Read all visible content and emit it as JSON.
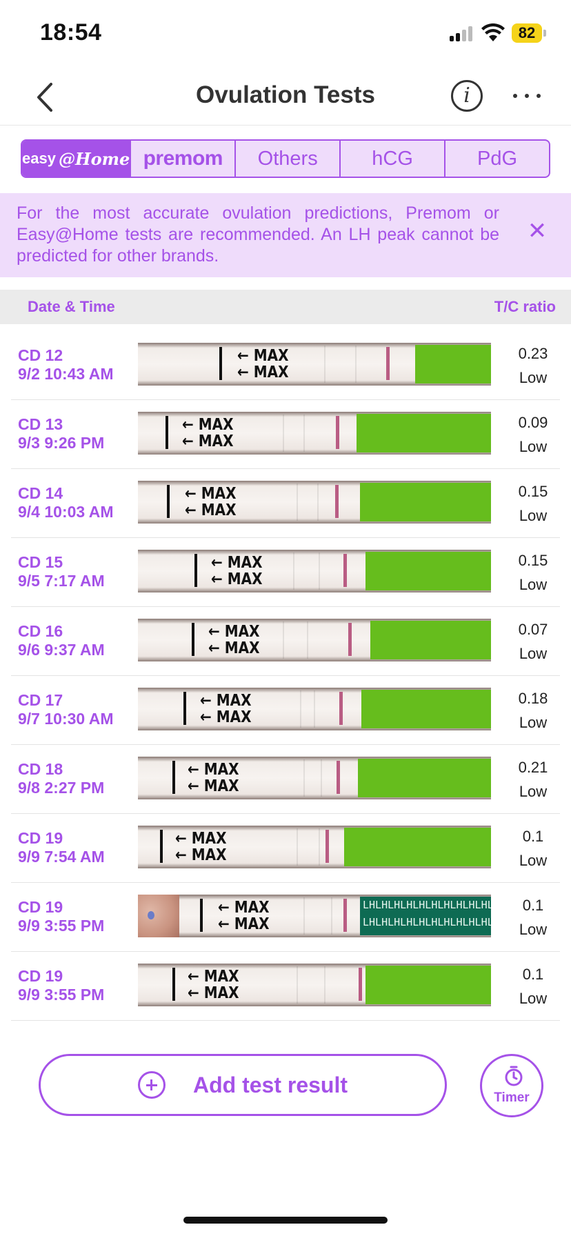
{
  "status": {
    "time": "18:54",
    "battery": "82"
  },
  "nav": {
    "title": "Ovulation Tests",
    "back_icon": "chevron-left-icon",
    "info_icon": "info-icon",
    "more_icon": "more-icon"
  },
  "tabs": [
    {
      "label_a": "easy",
      "label_b": "@Home",
      "active": true
    },
    {
      "label": "premom",
      "active": false
    },
    {
      "label": "Others",
      "active": false
    },
    {
      "label": "hCG",
      "active": false
    },
    {
      "label": "PdG",
      "active": false
    }
  ],
  "banner": {
    "text": "For the most accurate ovulation predictions, Premom or Easy@Home tests are recommended. An LH peak cannot be predicted for other brands.",
    "close": "✕"
  },
  "table": {
    "col_date": "Date & Time",
    "col_ratio": "T/C ratio"
  },
  "strip_text": {
    "max": "MAX",
    "lh": "LH"
  },
  "colors": {
    "accent": "#a552e8",
    "banner_bg": "#efdcfb",
    "green_pad": "#66bd1d",
    "lh_pad": "#0e6b53",
    "test_line": "#b34d78"
  },
  "rows": [
    {
      "cd": "CD 12",
      "datetime": "9/2 10:43 AM",
      "ratio": "0.23",
      "level": "Low"
    },
    {
      "cd": "CD 13",
      "datetime": "9/3 9:26 PM",
      "ratio": "0.09",
      "level": "Low"
    },
    {
      "cd": "CD 14",
      "datetime": "9/4 10:03 AM",
      "ratio": "0.15",
      "level": "Low"
    },
    {
      "cd": "CD 15",
      "datetime": "9/5 7:17 AM",
      "ratio": "0.15",
      "level": "Low"
    },
    {
      "cd": "CD 16",
      "datetime": "9/6 9:37 AM",
      "ratio": "0.07",
      "level": "Low"
    },
    {
      "cd": "CD 17",
      "datetime": "9/7 10:30 AM",
      "ratio": "0.18",
      "level": "Low"
    },
    {
      "cd": "CD 18",
      "datetime": "9/8 2:27 PM",
      "ratio": "0.21",
      "level": "Low"
    },
    {
      "cd": "CD 19",
      "datetime": "9/9 7:54 AM",
      "ratio": "0.1",
      "level": "Low"
    },
    {
      "cd": "CD 19",
      "datetime": "9/9 3:55 PM",
      "ratio": "0.1",
      "level": "Low"
    },
    {
      "cd": "CD 19",
      "datetime": "9/9 3:55 PM",
      "ratio": "0.1",
      "level": "Low"
    }
  ],
  "actions": {
    "add_label": "Add test result",
    "timer_label": "Timer"
  }
}
